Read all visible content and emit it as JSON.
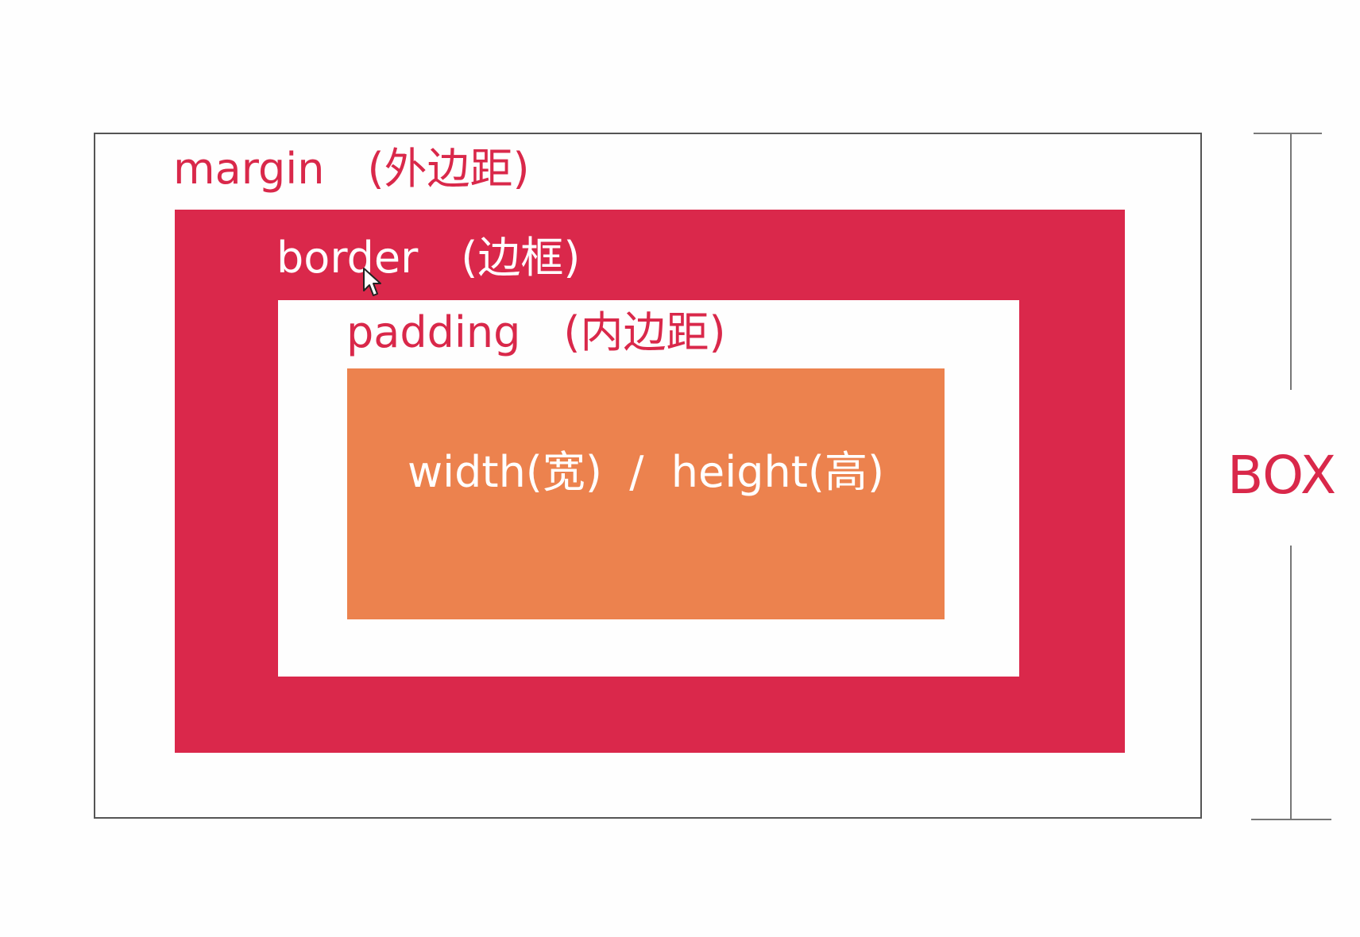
{
  "diagram": {
    "margin_label": "margin　(外边距)",
    "border_label": "border　(边框)",
    "padding_label": "padding　(内边距)",
    "content_label": "width(宽)  /  height(高)",
    "box_label": "BOX"
  },
  "colors": {
    "accent_red": "#da284b",
    "content_orange": "#ec824e",
    "outline_gray": "#555555",
    "background": "#fefefe"
  },
  "icons": {
    "cursor": "mouse-pointer-icon"
  }
}
